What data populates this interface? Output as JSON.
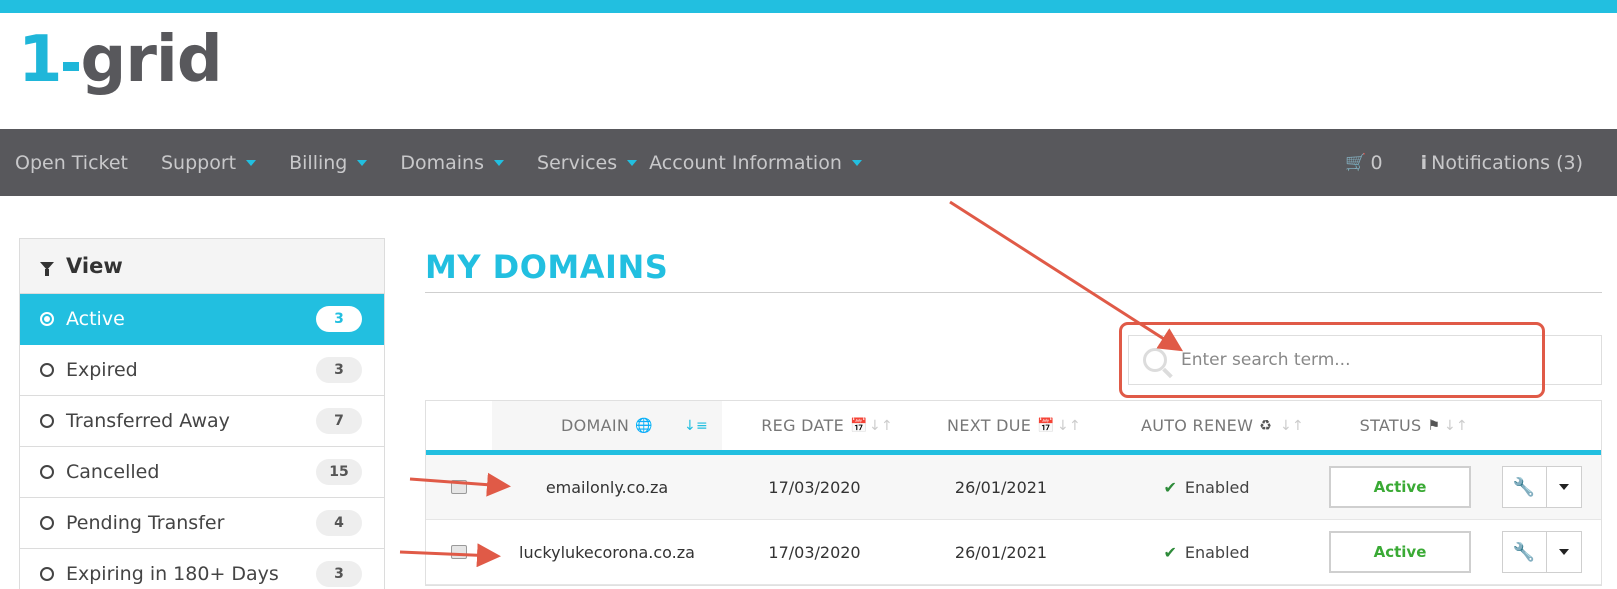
{
  "brand": {
    "logo_number": "1",
    "logo_word": "grid",
    "accent": "#22bfe0",
    "nav_bg": "#58585c"
  },
  "nav": {
    "items": [
      {
        "label": "Open Ticket",
        "dropdown": false
      },
      {
        "label": "Support",
        "dropdown": true
      },
      {
        "label": "Billing",
        "dropdown": true
      },
      {
        "label": "Domains",
        "dropdown": true
      },
      {
        "label": "Services",
        "dropdown": true
      },
      {
        "label": "Account Information",
        "dropdown": true
      }
    ],
    "cart_count": "0",
    "notifications": "Notifications (3)"
  },
  "sidebar": {
    "title": "View",
    "items": [
      {
        "label": "Active",
        "count": "3",
        "active": true
      },
      {
        "label": "Expired",
        "count": "3",
        "active": false
      },
      {
        "label": "Transferred Away",
        "count": "7",
        "active": false
      },
      {
        "label": "Cancelled",
        "count": "15",
        "active": false
      },
      {
        "label": "Pending Transfer",
        "count": "4",
        "active": false
      },
      {
        "label": "Expiring in 180+ Days",
        "count": "3",
        "active": false
      }
    ]
  },
  "main": {
    "title": "MY DOMAINS",
    "search": {
      "placeholder": "Enter search term...",
      "value": ""
    },
    "columns": [
      "DOMAIN",
      "REG DATE",
      "NEXT DUE",
      "AUTO RENEW",
      "STATUS"
    ],
    "rows": [
      {
        "domain": "emailonly.co.za",
        "reg_date": "17/03/2020",
        "next_due": "26/01/2021",
        "auto_renew": "Enabled",
        "status": "Active"
      },
      {
        "domain": "luckylukecorona.co.za",
        "reg_date": "17/03/2020",
        "next_due": "26/01/2021",
        "auto_renew": "Enabled",
        "status": "Active"
      }
    ]
  },
  "annotations": {
    "arrow_color": "#e05a47"
  }
}
